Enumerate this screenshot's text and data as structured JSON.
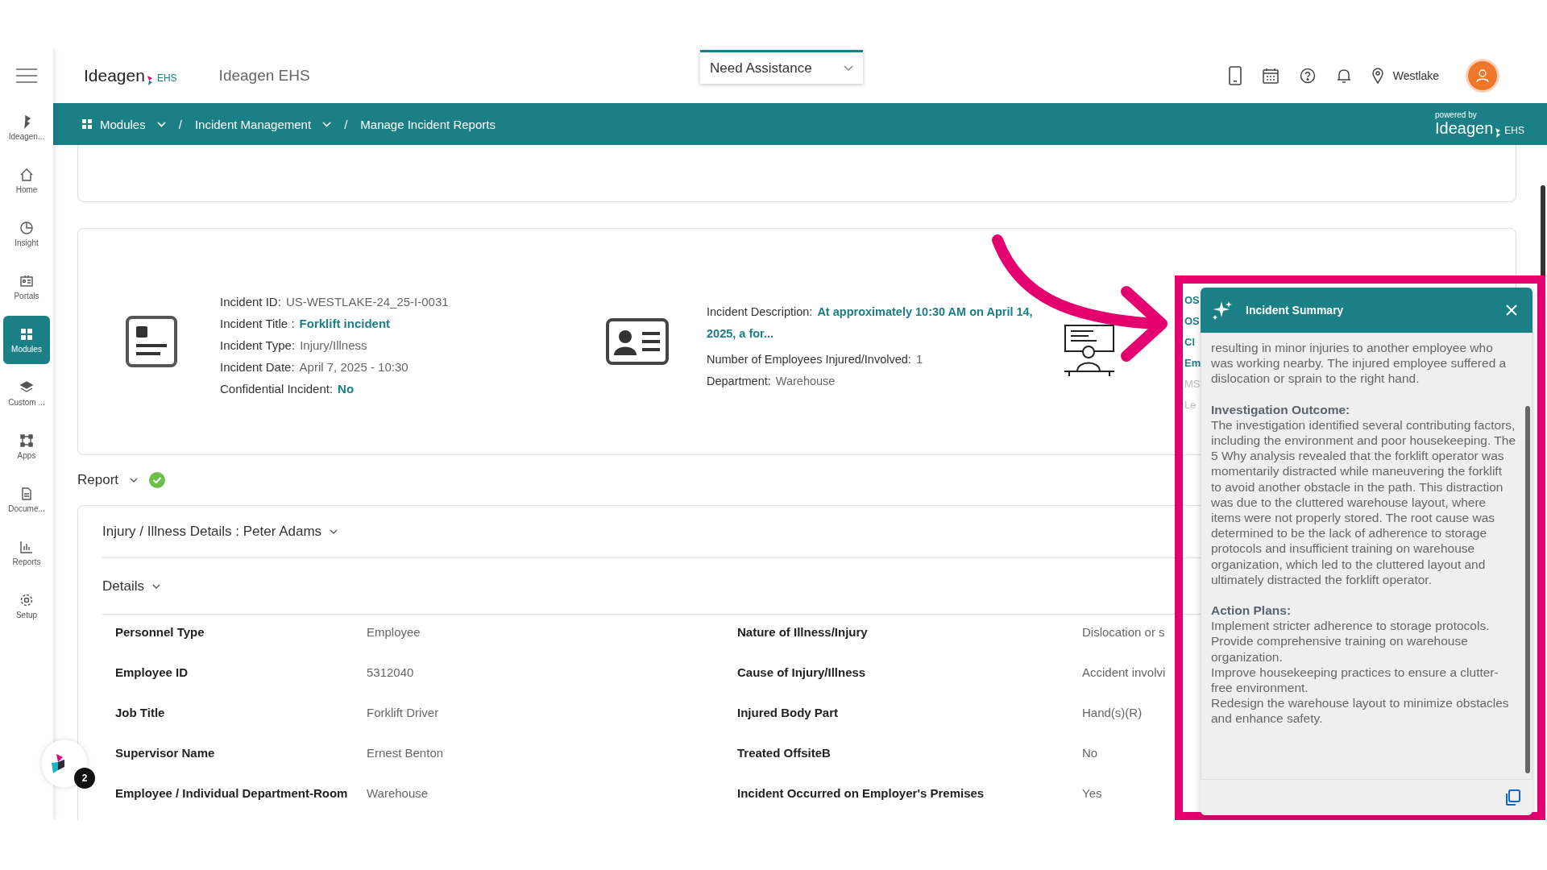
{
  "header": {
    "logo_text": "Ideagen",
    "logo_suffix": "EHS",
    "app_name": "Ideagen EHS",
    "assistance": {
      "value": "Need Assistance"
    },
    "location": "Westlake"
  },
  "breadcrumb": [
    {
      "kind": "link",
      "label": "Modules",
      "dropdown": true
    },
    {
      "kind": "separator",
      "label": "/"
    },
    {
      "kind": "link",
      "label": "Incident Management",
      "dropdown": true
    },
    {
      "kind": "separator",
      "label": "/"
    },
    {
      "kind": "link",
      "label": "Manage Incident Reports",
      "dropdown": false
    }
  ],
  "powered_by": {
    "caption": "powered by",
    "logo_text": "Ideagen",
    "logo_suffix": "EHS"
  },
  "sidebar": {
    "items": [
      {
        "label": "Ideagen...",
        "selected": false
      },
      {
        "label": "Home",
        "selected": false
      },
      {
        "label": "Insight",
        "selected": false
      },
      {
        "label": "Portals",
        "selected": false
      },
      {
        "label": "Modules",
        "selected": true
      },
      {
        "label": "Custom ...",
        "selected": false
      },
      {
        "label": "Apps",
        "selected": false
      },
      {
        "label": "Docume...",
        "selected": false
      },
      {
        "label": "Reports",
        "selected": false
      },
      {
        "label": "Setup",
        "selected": false
      }
    ]
  },
  "assistant_badge": {
    "count": "2"
  },
  "incident": {
    "fields_left": [
      {
        "label": "Incident ID:",
        "value": "US-WESTLAKE-24_25-I-0031",
        "emphasis": false
      },
      {
        "label": "Incident Title :",
        "value": "Forklift incident",
        "emphasis": true
      },
      {
        "label": "Incident Type:",
        "value": "Injury/Illness",
        "emphasis": false
      },
      {
        "label": "Incident Date:",
        "value": "April 7, 2025 - 10:30",
        "emphasis": false
      },
      {
        "label": "Confidential Incident:",
        "value": "No",
        "emphasis": true
      }
    ],
    "fields_right": [
      {
        "label": "Incident Description:",
        "value": "At approximately 10:30 AM on April 14, 2025, a for...",
        "emphasis": true
      },
      {
        "label": "Number of Employees Injured/Involved:",
        "value": "1",
        "emphasis": false
      },
      {
        "label": "Department:",
        "value": "Warehouse",
        "emphasis": false
      }
    ],
    "cut_column": [
      {
        "text": "OS",
        "muted": false
      },
      {
        "text": "OS",
        "muted": false
      },
      {
        "text": "Cl",
        "muted": false
      },
      {
        "text": "Em",
        "muted": false
      },
      {
        "text": "MS",
        "muted": true
      },
      {
        "text": "Le",
        "muted": true
      }
    ]
  },
  "report": {
    "title": "Report",
    "complete": true
  },
  "injury_section": {
    "title": "Injury / Illness Details : Peter Adams"
  },
  "details": {
    "title": "Details",
    "rows": [
      {
        "label": "Personnel Type",
        "value": "Employee",
        "label_2": "Nature of Illness/Injury",
        "value_2": "Dislocation or s"
      },
      {
        "label": "Employee ID",
        "value": "5312040",
        "label_2": "Cause of Injury/Illness",
        "value_2": "Accident involvi"
      },
      {
        "label": "Job Title",
        "value": "Forklift Driver",
        "label_2": "Injured Body Part",
        "value_2": "Hand(s)(R)"
      },
      {
        "label": "Supervisor Name",
        "value": "Ernest Benton",
        "label_2": "Treated OffsiteB",
        "value_2": "No"
      },
      {
        "label": "Employee / Individual Department-Room",
        "value": "Warehouse",
        "label_2": "Incident Occurred on Employer's Premises",
        "value_2": "Yes"
      }
    ]
  },
  "summary_panel": {
    "title": "Incident Summary",
    "sections": [
      {
        "lines": [
          "resulting in minor injuries to another employee who was working nearby. The injured employee suffered a dislocation or sprain to the right hand."
        ]
      },
      {
        "heading": "Investigation Outcome:",
        "lines": [
          "The investigation identified several contributing factors, including the environment and poor housekeeping. The 5 Why analysis revealed that the forklift operator was momentarily distracted while maneuvering the forklift to avoid another obstacle in the path. This distraction was due to the cluttered warehouse layout, where items were not properly stored. The root cause was determined to be the lack of adherence to storage protocols and insufficient training on warehouse organization, which led to the cluttered layout and ultimately distracted the forklift operator."
        ]
      },
      {
        "heading": "Action Plans:",
        "lines": [
          "Implement stricter adherence to storage protocols.",
          "Provide comprehensive training on warehouse organization.",
          "Improve housekeeping practices to ensure a clutter-free environment.",
          "Redesign the warehouse layout to minimize obstacles and enhance safety."
        ]
      }
    ]
  }
}
